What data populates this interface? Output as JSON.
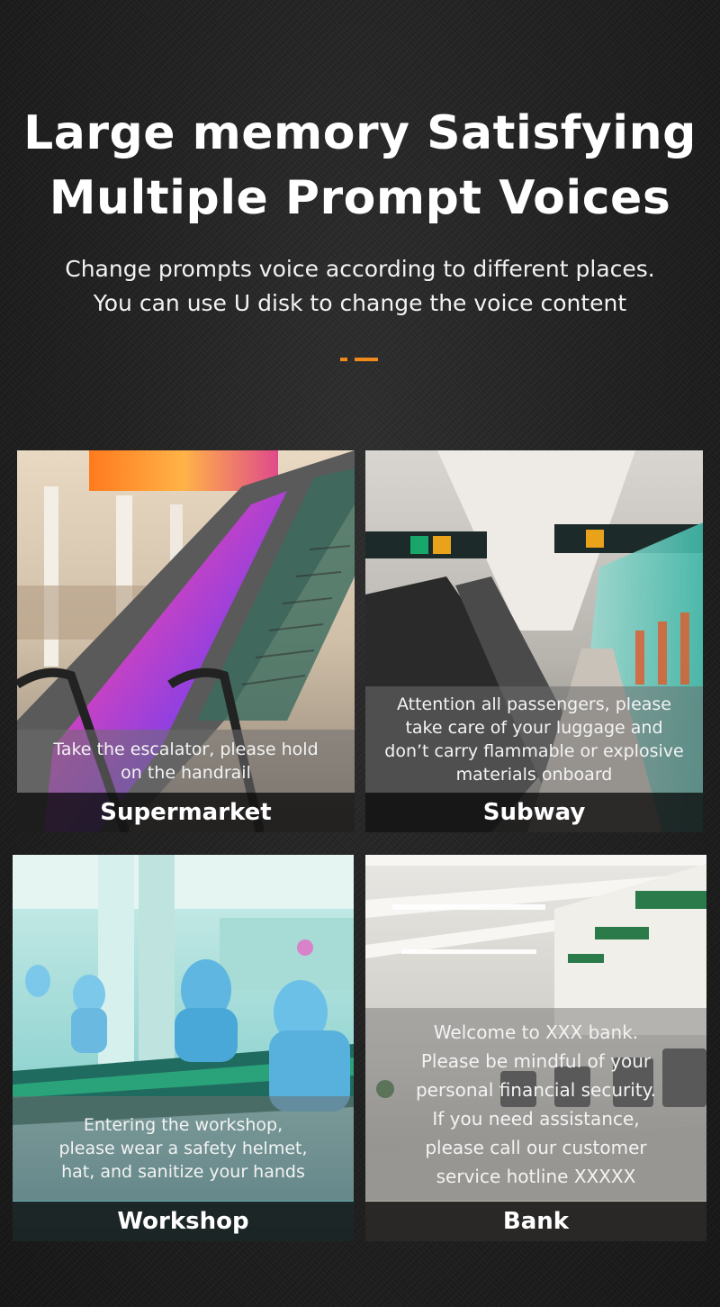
{
  "header": {
    "title_lines": [
      "Large memory Satisfying",
      "Multiple Prompt Voices"
    ],
    "subtitle_lines": [
      "Change prompts voice according to different places.",
      "You can use U disk to change the voice content"
    ]
  },
  "colors": {
    "accent": "#f08a1c",
    "label_bar": "#141414",
    "caption_overlay": "#6e6e6e"
  },
  "cards": [
    {
      "label": "Supermarket",
      "caption_lines": [
        "Take the escalator, please hold",
        "on the handrail"
      ]
    },
    {
      "label": "Subway",
      "caption_lines": [
        "Attention all passengers, please",
        "take care of your luggage and",
        "don’t carry flammable or explosive",
        "materials onboard"
      ]
    },
    {
      "label": "Workshop",
      "caption_lines": [
        "Entering the workshop,",
        "please wear a safety helmet,",
        "hat, and sanitize your hands"
      ]
    },
    {
      "label": "Bank",
      "caption_lines": [
        "Welcome to XXX bank.",
        "Please be mindful of your",
        "personal financial security.",
        "If you need assistance,",
        "please call our customer",
        "service hotline XXXXX"
      ]
    }
  ]
}
